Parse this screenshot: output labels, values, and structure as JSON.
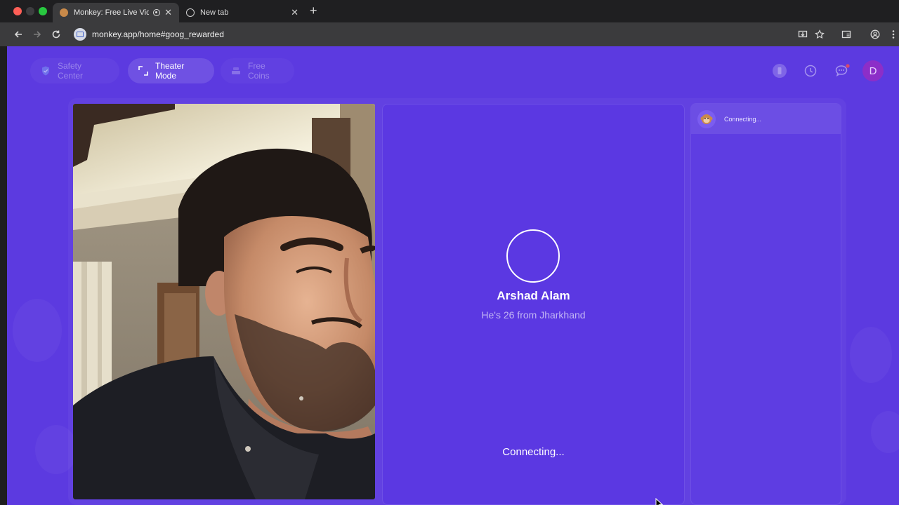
{
  "browser": {
    "tabs": [
      {
        "title": "Monkey: Free Live Video C",
        "active": true
      },
      {
        "title": "New tab",
        "active": false
      }
    ],
    "close_glyph": "✕",
    "new_tab_glyph": "+",
    "url": "monkey.app/home#goog_rewarded"
  },
  "header": {
    "safety_center": "Safety Center",
    "theater_mode": "Theater Mode",
    "free_coins": "Free Coins",
    "avatar_initial": "D"
  },
  "remote": {
    "name": "Arshad Alam",
    "info": "He's 26 from Jharkhand",
    "status": "Connecting..."
  },
  "chat": {
    "status": "Connecting..."
  },
  "colors": {
    "page_bg": "#5c3ae0",
    "avatar": "#8c2ec8",
    "tab_active": "#3b3b3d"
  }
}
